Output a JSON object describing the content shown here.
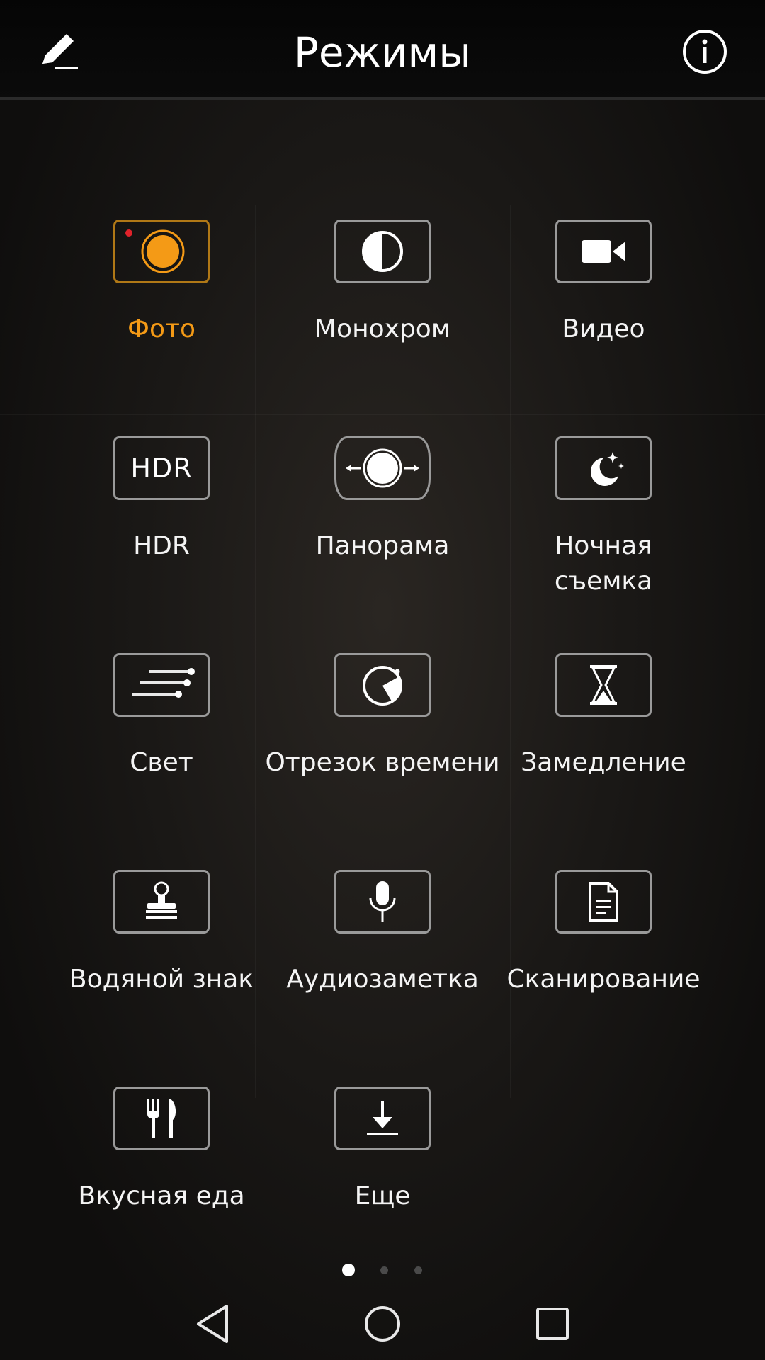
{
  "header": {
    "title": "Режимы",
    "edit_icon": "pencil-icon",
    "info_icon": "info-icon"
  },
  "modes": [
    {
      "label": "Фото",
      "icon": "photo-mode-icon",
      "active": true
    },
    {
      "label": "Монохром",
      "icon": "monochrome-icon",
      "active": false
    },
    {
      "label": "Видео",
      "icon": "video-camera-icon",
      "active": false
    },
    {
      "label": "HDR",
      "icon": "hdr-icon",
      "icon_text": "HDR",
      "active": false
    },
    {
      "label": "Панорама",
      "icon": "panorama-icon",
      "active": false
    },
    {
      "label": "Ночная\nсъемка",
      "icon": "night-moon-icon",
      "active": false
    },
    {
      "label": "Свет",
      "icon": "light-trails-icon",
      "active": false
    },
    {
      "label": "Отрезок времени",
      "icon": "time-lapse-icon",
      "active": false
    },
    {
      "label": "Замедление",
      "icon": "hourglass-icon",
      "active": false
    },
    {
      "label": "Водяной знак",
      "icon": "stamp-icon",
      "active": false
    },
    {
      "label": "Аудиозаметка",
      "icon": "microphone-icon",
      "active": false
    },
    {
      "label": "Сканирование",
      "icon": "document-icon",
      "active": false
    },
    {
      "label": "Вкусная еда",
      "icon": "fork-knife-icon",
      "active": false
    },
    {
      "label": "Еще",
      "icon": "download-icon",
      "active": false
    }
  ],
  "pager": {
    "pages": 3,
    "current": 1
  },
  "colors": {
    "accent": "#f49a16",
    "active_border": "#b07816",
    "icon_border": "#9a9a9a",
    "text": "#f4f4f4"
  },
  "navbar": {
    "back_icon": "back-triangle-icon",
    "home_icon": "home-circle-icon",
    "recents_icon": "recents-square-icon"
  }
}
